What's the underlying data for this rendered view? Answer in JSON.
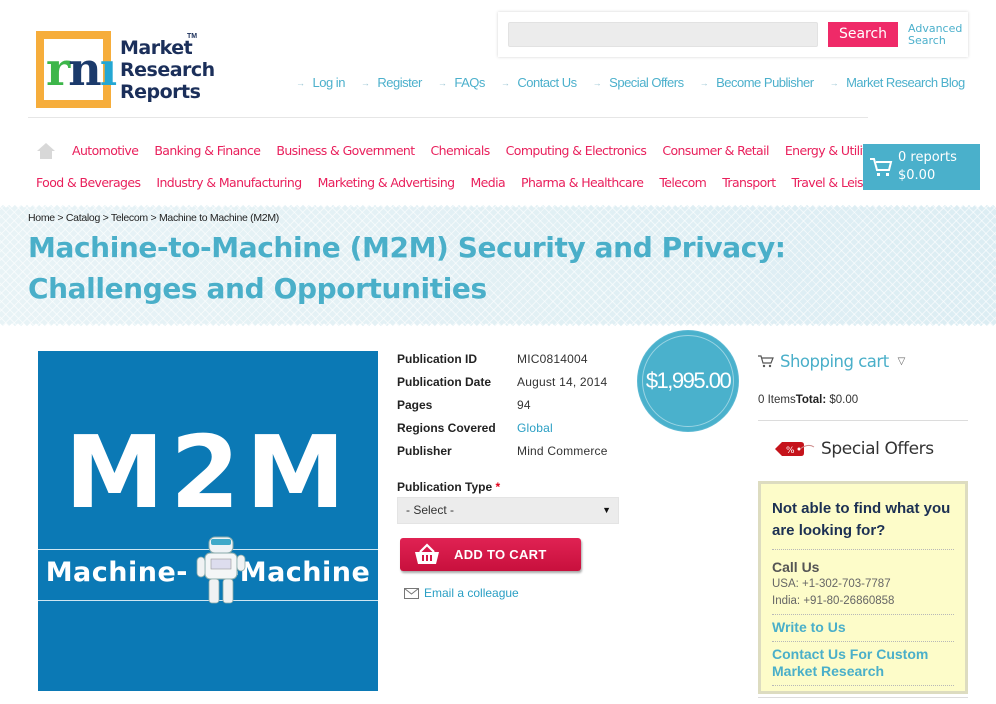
{
  "logo": {
    "line1": "Market",
    "line2": "Research",
    "line3": "Reports",
    "tm": "TM",
    "letter": "m"
  },
  "search": {
    "value": "",
    "placeholder": "",
    "button_label": "Search",
    "advanced_line1": "Advanced",
    "advanced_line2": "Search"
  },
  "top_links": [
    {
      "label": "Log in"
    },
    {
      "label": "Register"
    },
    {
      "label": "FAQs"
    },
    {
      "label": "Contact Us"
    },
    {
      "label": "Special Offers"
    },
    {
      "label": "Become Publisher"
    },
    {
      "label": "Market Research Blog"
    }
  ],
  "categories_row1": [
    {
      "label": "Automotive"
    },
    {
      "label": "Banking & Finance"
    },
    {
      "label": "Business & Government"
    },
    {
      "label": "Chemicals"
    },
    {
      "label": "Computing & Electronics"
    },
    {
      "label": "Consumer & Retail"
    },
    {
      "label": "Energy & Utilities"
    }
  ],
  "categories_row2": [
    {
      "label": "Food & Beverages"
    },
    {
      "label": "Industry & Manufacturing"
    },
    {
      "label": "Marketing & Advertising"
    },
    {
      "label": "Media"
    },
    {
      "label": "Pharma & Healthcare"
    },
    {
      "label": "Telecom"
    },
    {
      "label": "Transport"
    },
    {
      "label": "Travel & Leisure"
    }
  ],
  "header_cart": {
    "reports": "0 reports",
    "total": "$0.00"
  },
  "breadcrumb": [
    "Home",
    "Catalog",
    "Telecom",
    "Machine to Machine (M2M)"
  ],
  "breadcrumb_sep": ">",
  "title": "Machine-to-Machine (M2M) Security and Privacy: Challenges and Opportunities",
  "product_image": {
    "headline": "M2M",
    "subtitle_left": "Machine-",
    "subtitle_right": "-Machine"
  },
  "details": [
    {
      "label": "Publication ID",
      "value": "MIC0814004",
      "link": false
    },
    {
      "label": "Publication Date",
      "value": "August 14, 2014",
      "link": false
    },
    {
      "label": "Pages",
      "value": "94",
      "link": false
    },
    {
      "label": "Regions Covered",
      "value": "Global",
      "link": true
    },
    {
      "label": "Publisher",
      "value": "Mind Commerce",
      "link": false
    }
  ],
  "publication_type": {
    "label": "Publication Type",
    "required_mark": "*",
    "selected": "- Select -"
  },
  "add_to_cart_label": "ADD TO CART",
  "email_colleague_label": "Email a colleague",
  "price": "$1,995.00",
  "sidebar": {
    "shopping_cart_title": "Shopping cart",
    "items_text": "0 Items",
    "total_label": "Total:",
    "total_value": "$0.00",
    "special_offers_title": "Special Offers",
    "special_offers_tag": "%",
    "help": {
      "heading": "Not able to find what you are looking for?",
      "call_heading": "Call Us",
      "phone_usa": "USA: +1-302-703-7787",
      "phone_india": "India: +91-80-26860858",
      "write_label": "Write to Us",
      "custom_label": "Contact Us For Custom Market Research"
    }
  },
  "colors": {
    "accent_teal": "#4aafc9",
    "category_pink": "#e9205c",
    "search_button": "#ef2a68",
    "add_to_cart": "#d31846",
    "product_blue": "#0b79b5",
    "help_box_bg": "#fdfcc9"
  }
}
